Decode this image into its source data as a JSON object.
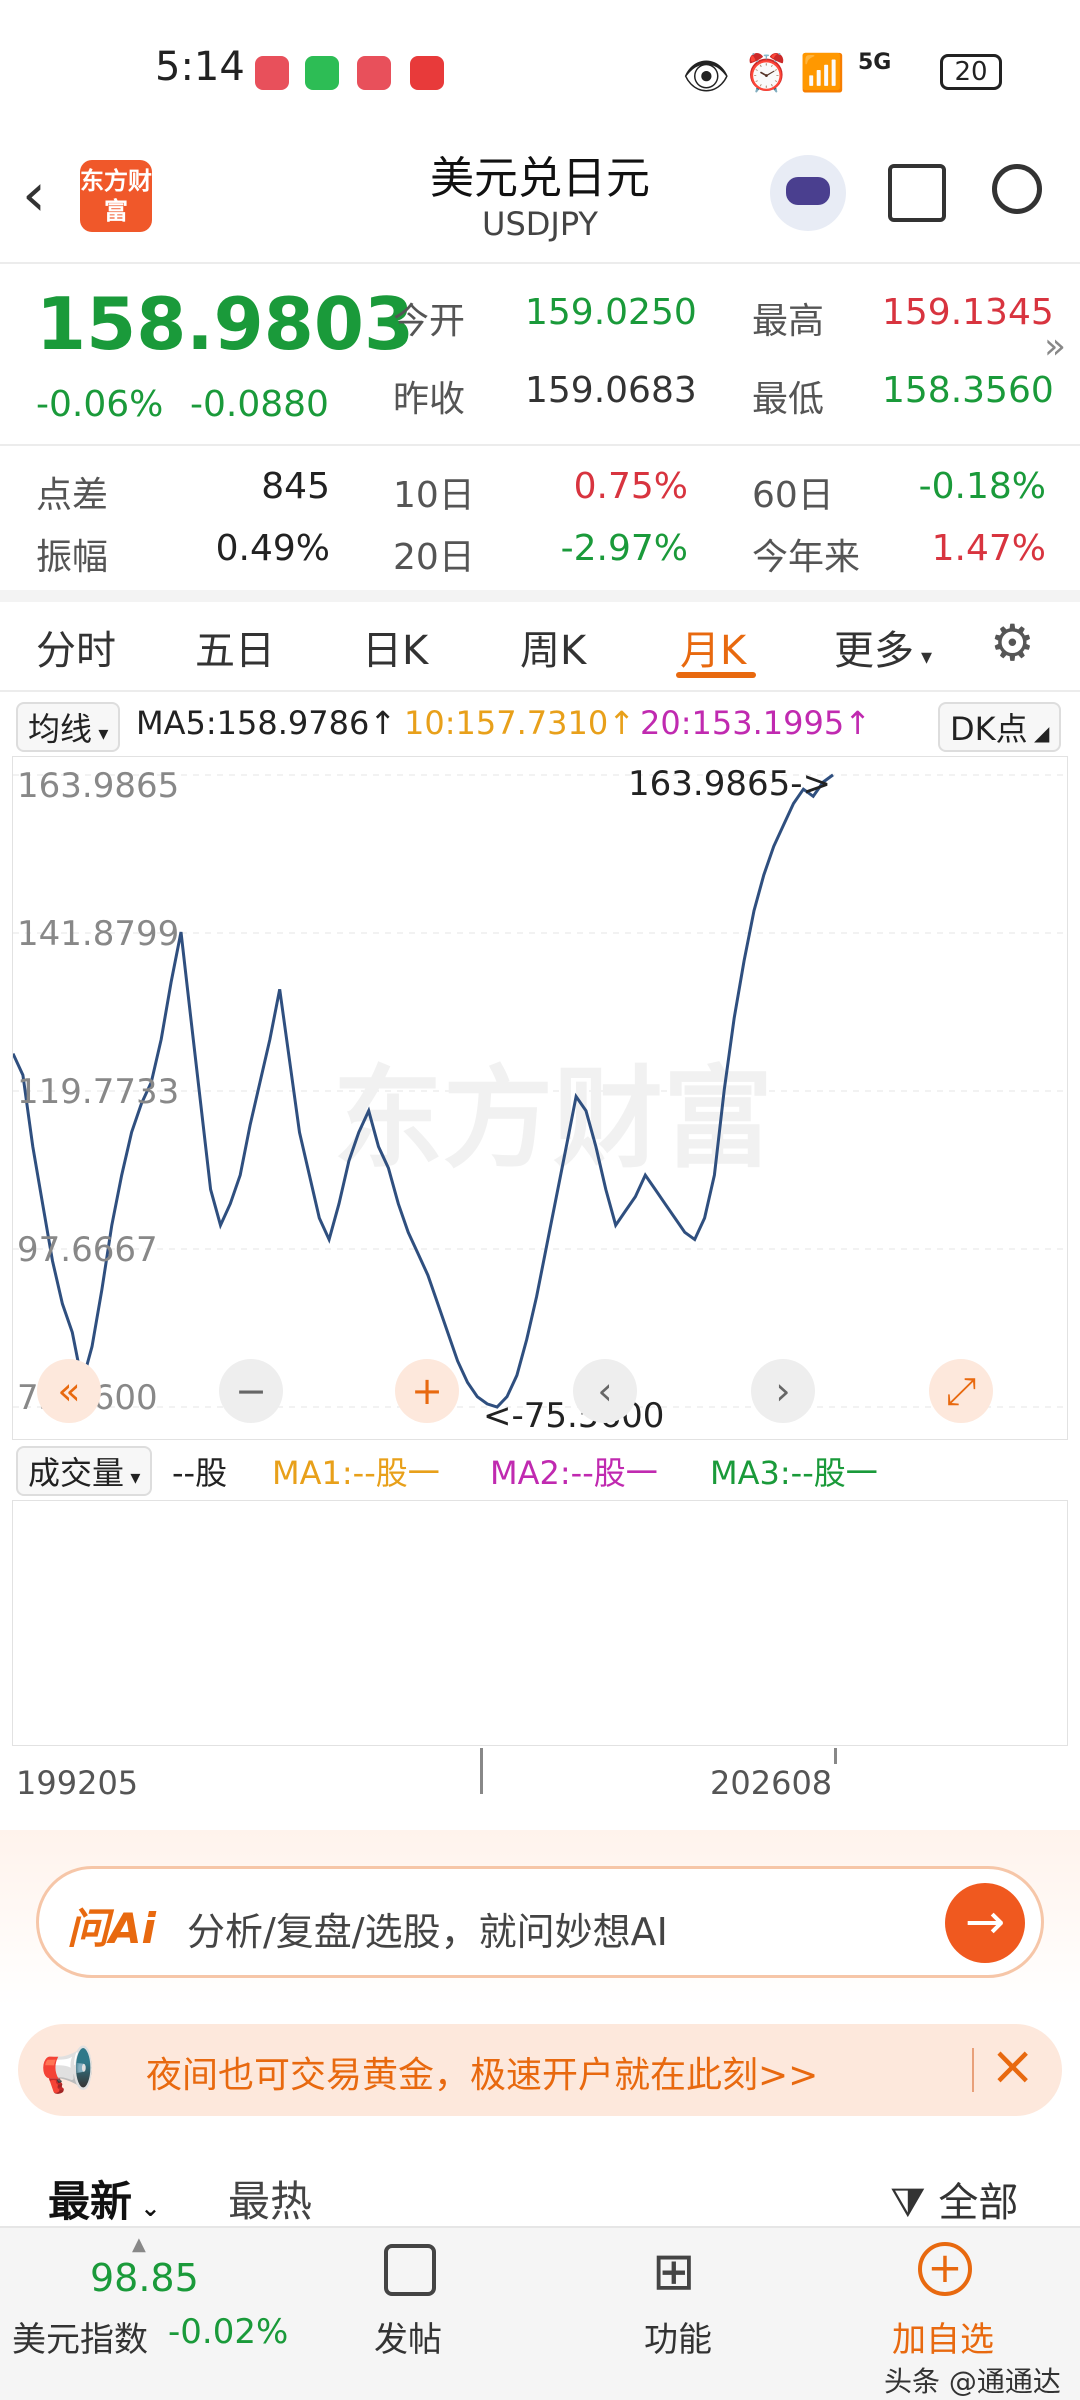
{
  "status": {
    "time": "5:14",
    "battery": "20",
    "network": "5G"
  },
  "header": {
    "title": "美元兑日元",
    "symbol": "USDJPY",
    "logo": "东方财富"
  },
  "quote": {
    "price": "158.9803",
    "change_pct": "-0.06%",
    "change": "-0.0880",
    "open_label": "今开",
    "open": "159.0250",
    "prev_label": "昨收",
    "prev": "159.0683",
    "high_label": "最高",
    "high": "159.1345",
    "low_label": "最低",
    "low": "158.3560"
  },
  "stats": {
    "spread_label": "点差",
    "spread": "845",
    "amp_label": "振幅",
    "amp": "0.49%",
    "d10_label": "10日",
    "d10": "0.75%",
    "d20_label": "20日",
    "d20": "-2.97%",
    "d60_label": "60日",
    "d60": "-0.18%",
    "ytd_label": "今年来",
    "ytd": "1.47%"
  },
  "tabs": [
    "分时",
    "五日",
    "日K",
    "周K",
    "月K",
    "更多"
  ],
  "ma": {
    "selector": "均线",
    "ma5": "MA5:158.9786↑",
    "ma10": "10:157.7310↑",
    "ma20": "20:153.1995↑",
    "dk": "DK点"
  },
  "chart_data": {
    "type": "line",
    "y_ticks": [
      "163.9865",
      "141.8799",
      "119.7733",
      "97.6667",
      "75.5600"
    ],
    "x_labels": [
      "199205",
      "202608"
    ],
    "max_label": "163.9865->",
    "min_label": "<-75.5600",
    "ylim": [
      75.56,
      163.9865
    ],
    "series": [
      {
        "values": [
          125,
          122,
          112,
          104,
          96,
          90,
          86,
          79,
          84,
          92,
          101,
          108,
          114,
          118,
          121,
          127,
          135,
          142,
          130,
          118,
          106,
          101,
          104,
          108,
          115,
          121,
          127,
          134,
          124,
          114,
          108,
          102,
          99,
          104,
          110,
          114,
          117,
          112,
          109,
          104,
          100,
          97,
          94,
          90,
          86,
          82,
          79,
          77,
          76,
          75.56,
          77,
          80,
          85,
          91,
          98,
          105,
          112,
          119,
          117,
          112,
          106,
          101,
          103,
          105,
          108,
          106,
          104,
          102,
          100,
          99,
          102,
          108,
          120,
          130,
          138,
          145,
          150,
          154,
          157,
          160,
          162,
          161,
          163,
          164
        ]
      }
    ]
  },
  "volume": {
    "selector": "成交量",
    "unit": "--股",
    "ma1": "MA1:--股一",
    "ma2": "MA2:--股一",
    "ma3": "MA3:--股一"
  },
  "ai": {
    "brand": "问Ai",
    "placeholder": "分析/复盘/选股，就问妙想AI"
  },
  "promo": {
    "text": "夜间也可交易黄金，极速开户就在此刻>>"
  },
  "feed": {
    "latest": "最新",
    "hot": "最热",
    "filter": "全部"
  },
  "bottom": {
    "index_value": "98.85",
    "index_name": "美元指数",
    "index_change": "-0.02%",
    "post": "发帖",
    "func": "功能",
    "add": "加自选"
  },
  "watermark": "东方财富",
  "credit": "头条 @通通达",
  "colors": {
    "up": "#d8343f",
    "down": "#1a9a3a",
    "accent": "#e8690f",
    "line": "#2f4f7f"
  }
}
